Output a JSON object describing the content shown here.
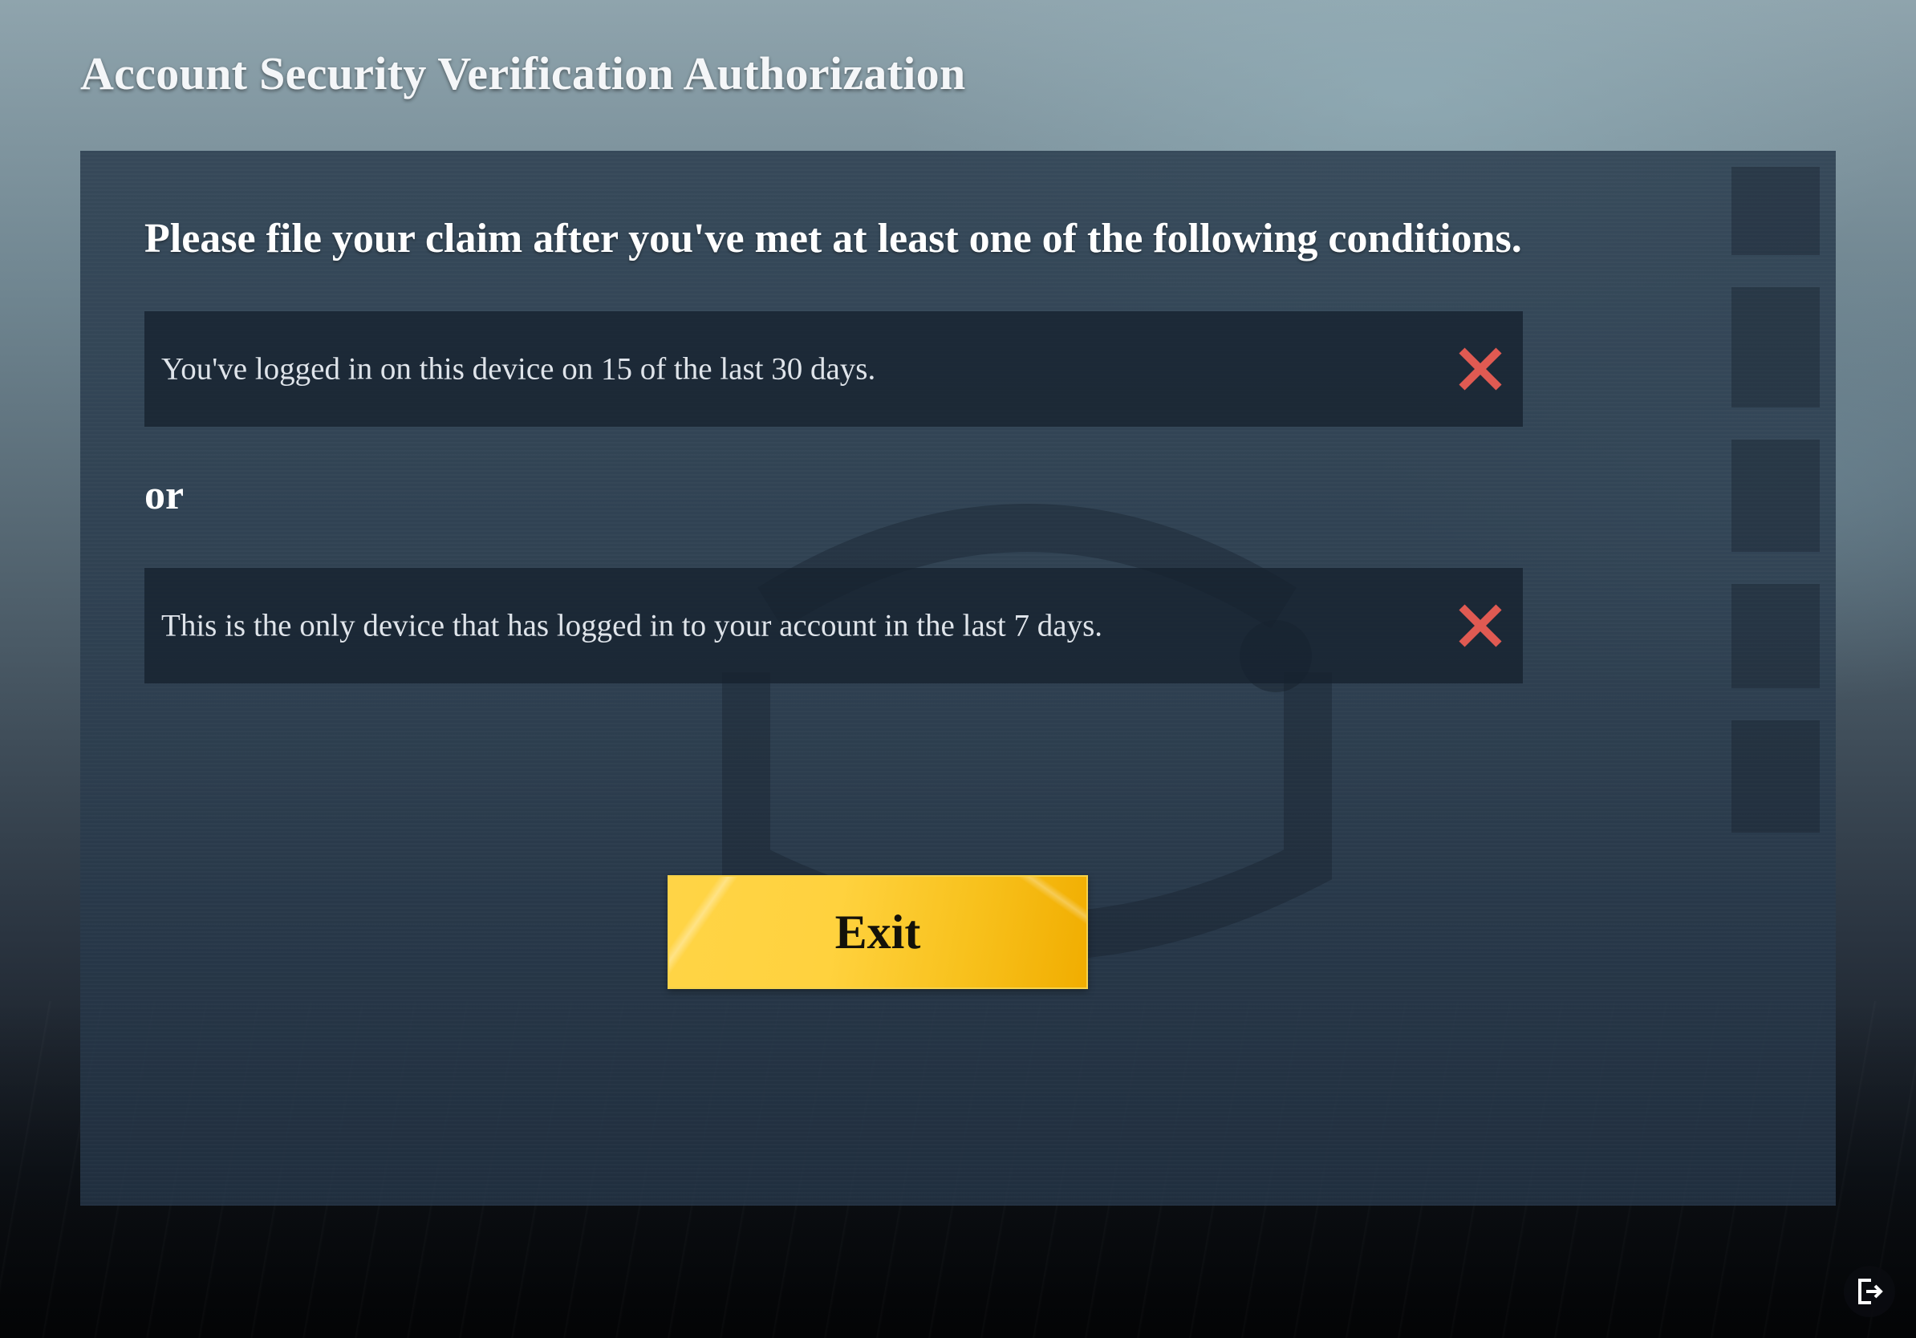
{
  "title": "Account Security Verification Authorization",
  "panel": {
    "heading": "Please file your claim after you've met at least one of the following conditions.",
    "conditions": [
      {
        "text": "You've logged in on this device on 15 of the last 30 days.",
        "met": false,
        "status_icon": "cross-icon"
      },
      {
        "text": "This is the only device that has logged in to your account in the last 7 days.",
        "met": false,
        "status_icon": "cross-icon"
      }
    ],
    "separator": "or"
  },
  "exit_button": {
    "label": "Exit"
  },
  "corner_button": {
    "icon": "logout-icon"
  },
  "colors": {
    "title_text": "#f4f6f8",
    "panel_bg": "#263a4c",
    "row_bg": "#16212e",
    "fail_cross": "#e05a52",
    "button_gold": "#ffd23e",
    "button_text": "#14120a"
  }
}
